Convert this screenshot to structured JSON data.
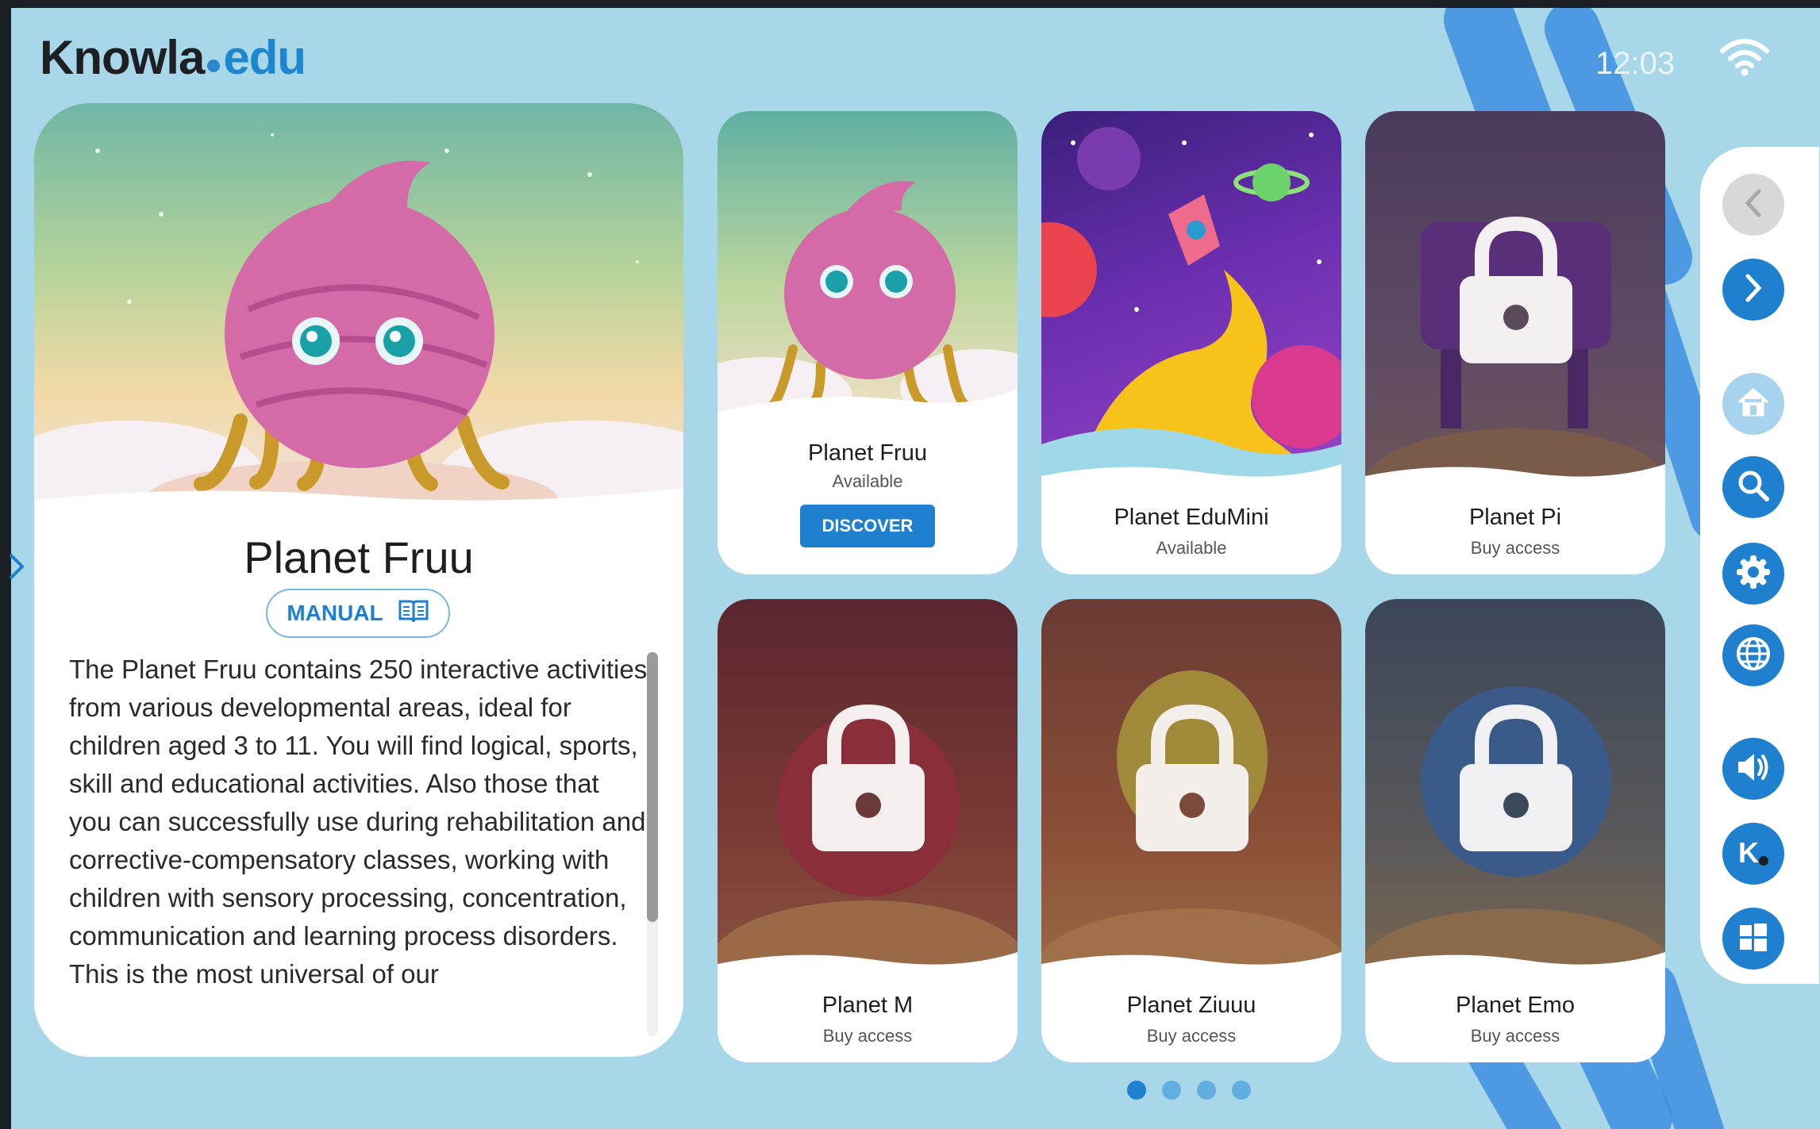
{
  "header": {
    "logo_main": "Knowla",
    "logo_suffix": "edu",
    "clock": "12:03"
  },
  "feature": {
    "title": "Planet Fruu",
    "manual_label": "MANUAL",
    "description": "The Planet Fruu contains 250 interactive activities from various developmental areas, ideal for children aged 3 to 11. You will find logical, sports, skill and educational activities. Also those that you can successfully use during rehabilitation and corrective-compensatory classes, working with children with sensory processing, concentration, communication and learning process disorders. This is the most universal of our"
  },
  "cards": [
    {
      "name": "Planet Fruu",
      "status": "Available",
      "button": "DISCOVER"
    },
    {
      "name": "Planet EduMini",
      "status": "Available"
    },
    {
      "name": "Planet Pi",
      "status": "Buy access"
    },
    {
      "name": "Planet M",
      "status": "Buy access"
    },
    {
      "name": "Planet Ziuuu",
      "status": "Buy access"
    },
    {
      "name": "Planet Emo",
      "status": "Buy access"
    }
  ],
  "side_menu": [
    "back-icon",
    "forward-icon",
    "home-icon",
    "search-icon",
    "gear-icon",
    "globe-icon",
    "speaker-icon",
    "knowla-icon",
    "windows-icon"
  ],
  "pager": {
    "pages": 4,
    "current": 1
  },
  "colors": {
    "accent": "#1f80cf",
    "background": "#a9d7ea",
    "card": "#ffffff"
  }
}
